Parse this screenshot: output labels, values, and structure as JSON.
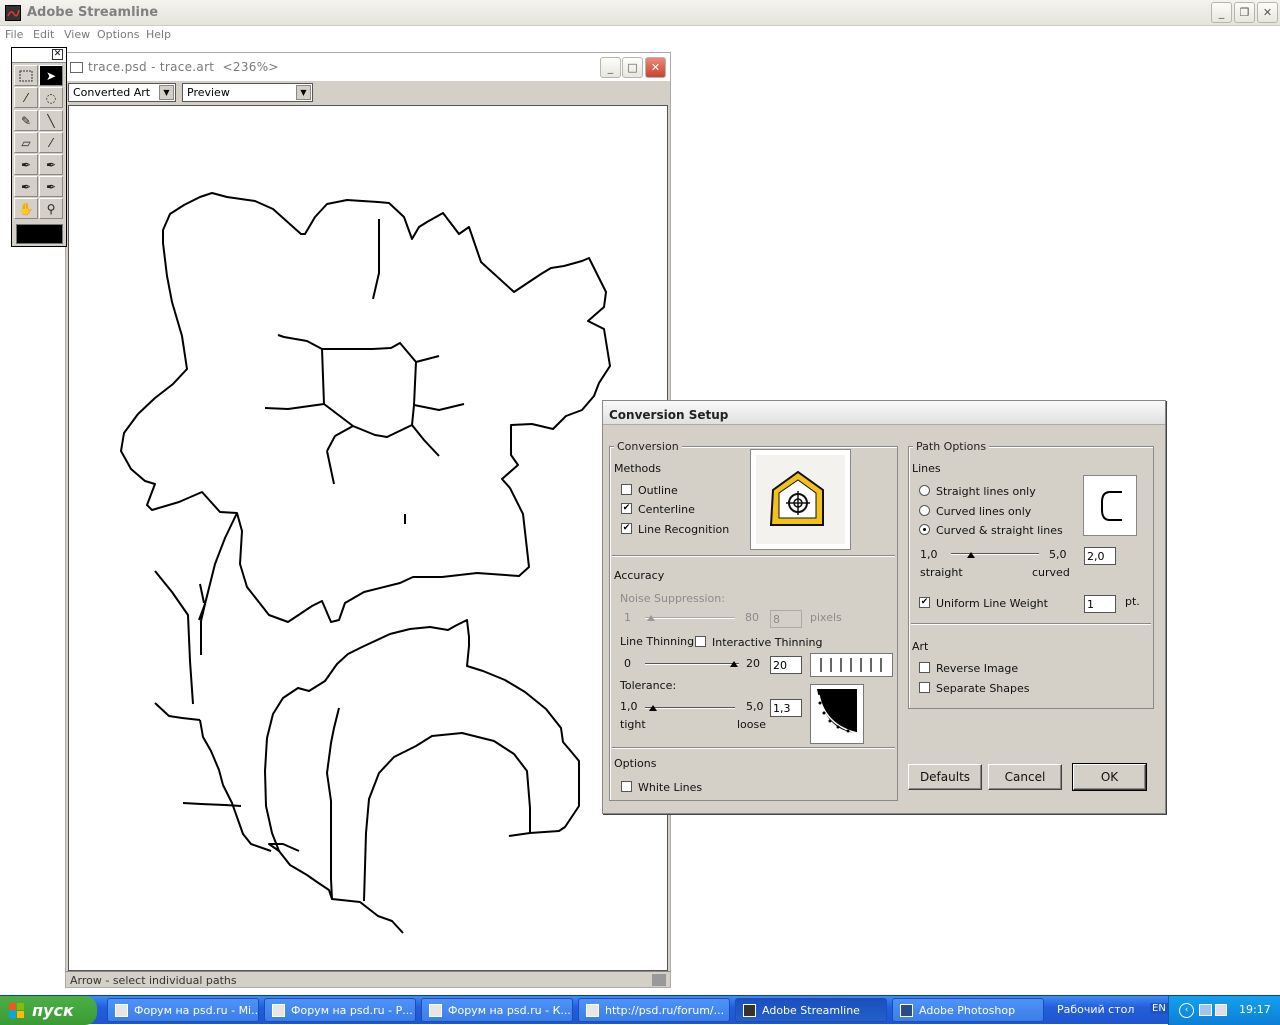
{
  "app": {
    "title": "Adobe Streamline",
    "icon": "streamline-app-icon"
  },
  "menubar": [
    "File",
    "Edit",
    "View",
    "Options",
    "Help"
  ],
  "document": {
    "title": "trace.psd - trace.art  <236%>",
    "view_mode": "Converted Art",
    "display_mode": "Preview",
    "status": "Arrow - select individual paths"
  },
  "toolbox": {
    "tools": [
      "marquee-tool",
      "arrow-tool",
      "magic-wand-tool",
      "lasso-tool",
      "pencil-tool",
      "line-tool",
      "eraser-tool",
      "eyedropper-tool",
      "pen-tool",
      "pen-anchor-tool",
      "add-anchor-tool",
      "delete-anchor-tool",
      "hand-tool",
      "zoom-tool"
    ],
    "color": "#000000"
  },
  "dialog": {
    "title": "Conversion Setup",
    "conversion": {
      "group_label": "Conversion",
      "methods_label": "Methods",
      "outline": {
        "label": "Outline",
        "checked": false
      },
      "centerline": {
        "label": "Centerline",
        "checked": true
      },
      "line_recognition": {
        "label": "Line Recognition",
        "checked": true
      }
    },
    "accuracy": {
      "label": "Accuracy",
      "noise_label": "Noise Suppression:",
      "noise_min": "1",
      "noise_max": "80",
      "noise_value": "8",
      "noise_unit": "pixels",
      "line_thinning_label": "Line Thinning:",
      "interactive_thinning": {
        "label": "Interactive Thinning",
        "checked": false
      },
      "thin_min": "0",
      "thin_max": "20",
      "thin_value": "20",
      "tolerance_label": "Tolerance:",
      "tol_min": "1,0",
      "tol_max": "5,0",
      "tol_value": "1,3",
      "tol_min_label": "tight",
      "tol_max_label": "loose"
    },
    "options": {
      "label": "Options",
      "white_lines": {
        "label": "White Lines",
        "checked": false
      }
    },
    "path_options": {
      "group_label": "Path Options",
      "lines_label": "Lines",
      "straight_only": {
        "label": "Straight lines only",
        "selected": false
      },
      "curved_only": {
        "label": "Curved lines only",
        "selected": false
      },
      "curved_straight": {
        "label": "Curved & straight lines",
        "selected": true
      },
      "curve_min": "1,0",
      "curve_max": "5,0",
      "curve_value": "2,0",
      "curve_min_label": "straight",
      "curve_max_label": "curved",
      "uniform_weight": {
        "label": "Uniform Line Weight",
        "checked": true
      },
      "weight_value": "1",
      "weight_unit": "pt."
    },
    "art": {
      "label": "Art",
      "reverse_image": {
        "label": "Reverse Image",
        "checked": false
      },
      "separate_shapes": {
        "label": "Separate Shapes",
        "checked": false
      }
    },
    "buttons": {
      "defaults": "Defaults",
      "cancel": "Cancel",
      "ok": "OK"
    }
  },
  "taskbar": {
    "start": "пуск",
    "tasks": [
      "Форум на psd.ru - Mi...",
      "Форум на psd.ru - Р...",
      "Форум на psd.ru - К...",
      "http://psd.ru/forum/...",
      "Adobe Streamline",
      "Adobe Photoshop"
    ],
    "active_task": "Adobe Streamline",
    "desktop_label": "Рабочий стол",
    "lang": "EN",
    "clock": "19:17"
  }
}
